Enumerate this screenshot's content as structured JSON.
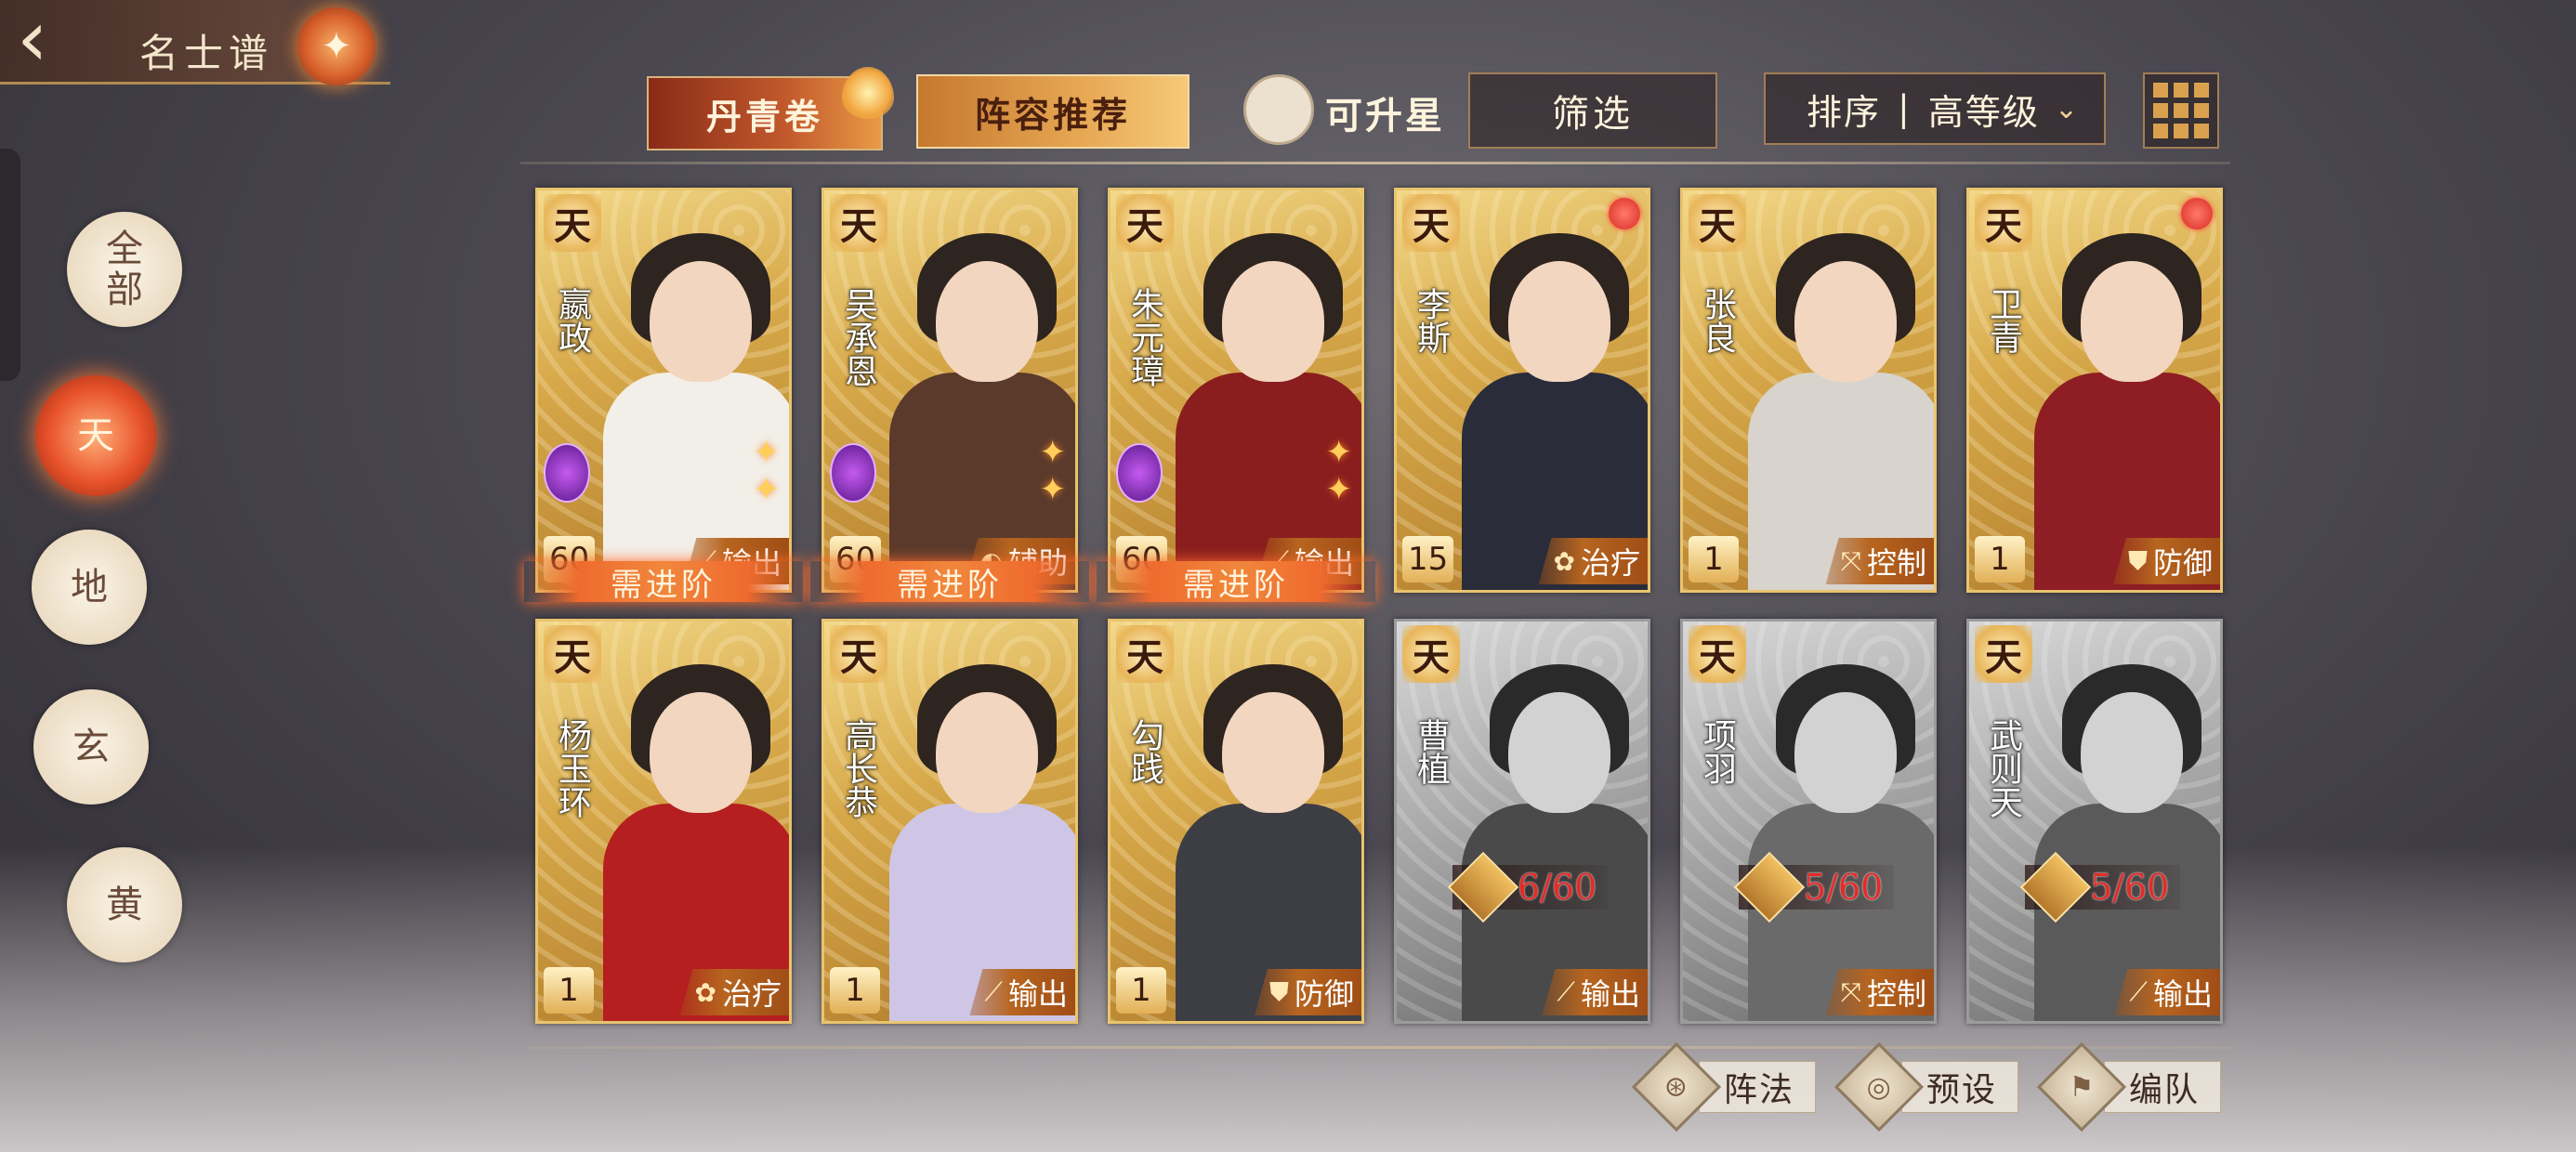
{
  "header": {
    "back_icon": "‹",
    "title": "名士谱",
    "emblem": "✦"
  },
  "tabs": [
    {
      "label": "丹青卷"
    },
    {
      "label": "阵容推荐"
    }
  ],
  "upgradable_label": "可升星",
  "filter_label": "筛选",
  "sort": {
    "label": "排序",
    "separator": "|",
    "value": "高等级",
    "chevron": "⌄"
  },
  "side_tabs": [
    {
      "label": "全部"
    },
    {
      "label": "天"
    },
    {
      "label": "地"
    },
    {
      "label": "玄"
    },
    {
      "label": "黄"
    }
  ],
  "role_icons": {
    "输出": "⟋",
    "辅助": "◐",
    "治疗": "✿",
    "控制": "⤧",
    "防御": "⛊"
  },
  "cards": [
    {
      "tier": "天",
      "name": "嬴政",
      "level": "60",
      "role": "输出",
      "role_icon": "⟋",
      "owned": true,
      "red_dot": false,
      "advance": "需进阶"
    },
    {
      "tier": "天",
      "name": "吴承恩",
      "level": "60",
      "role": "辅助",
      "role_icon": "◐",
      "owned": true,
      "red_dot": false,
      "advance": "需进阶"
    },
    {
      "tier": "天",
      "name": "朱元璋",
      "level": "60",
      "role": "输出",
      "role_icon": "⟋",
      "owned": true,
      "red_dot": false,
      "advance": "需进阶"
    },
    {
      "tier": "天",
      "name": "李斯",
      "level": "15",
      "role": "治疗",
      "role_icon": "✿",
      "owned": true,
      "red_dot": true
    },
    {
      "tier": "天",
      "name": "张良",
      "level": "1",
      "role": "控制",
      "role_icon": "⤧",
      "owned": true,
      "red_dot": false
    },
    {
      "tier": "天",
      "name": "卫青",
      "level": "1",
      "role": "防御",
      "role_icon": "⛊",
      "owned": true,
      "red_dot": true
    },
    {
      "tier": "天",
      "name": "杨玉环",
      "level": "1",
      "role": "治疗",
      "role_icon": "✿",
      "owned": true,
      "red_dot": false
    },
    {
      "tier": "天",
      "name": "高长恭",
      "level": "1",
      "role": "输出",
      "role_icon": "⟋",
      "owned": true,
      "red_dot": false
    },
    {
      "tier": "天",
      "name": "勾践",
      "level": "1",
      "role": "防御",
      "role_icon": "⛊",
      "owned": true,
      "red_dot": false
    },
    {
      "tier": "天",
      "name": "曹植",
      "fragments": "6/60",
      "role": "输出",
      "role_icon": "⟋",
      "owned": false,
      "red_dot": false
    },
    {
      "tier": "天",
      "name": "项羽",
      "fragments": "5/60",
      "role": "控制",
      "role_icon": "⤧",
      "owned": false,
      "red_dot": false
    },
    {
      "tier": "天",
      "name": "武则天",
      "fragments": "5/60",
      "role": "输出",
      "role_icon": "⟋",
      "owned": false,
      "red_dot": false
    }
  ],
  "bottom_buttons": [
    {
      "label": "阵法",
      "icon": "⊛"
    },
    {
      "label": "预设",
      "icon": "◎"
    },
    {
      "label": "编队",
      "icon": "⚑"
    }
  ]
}
